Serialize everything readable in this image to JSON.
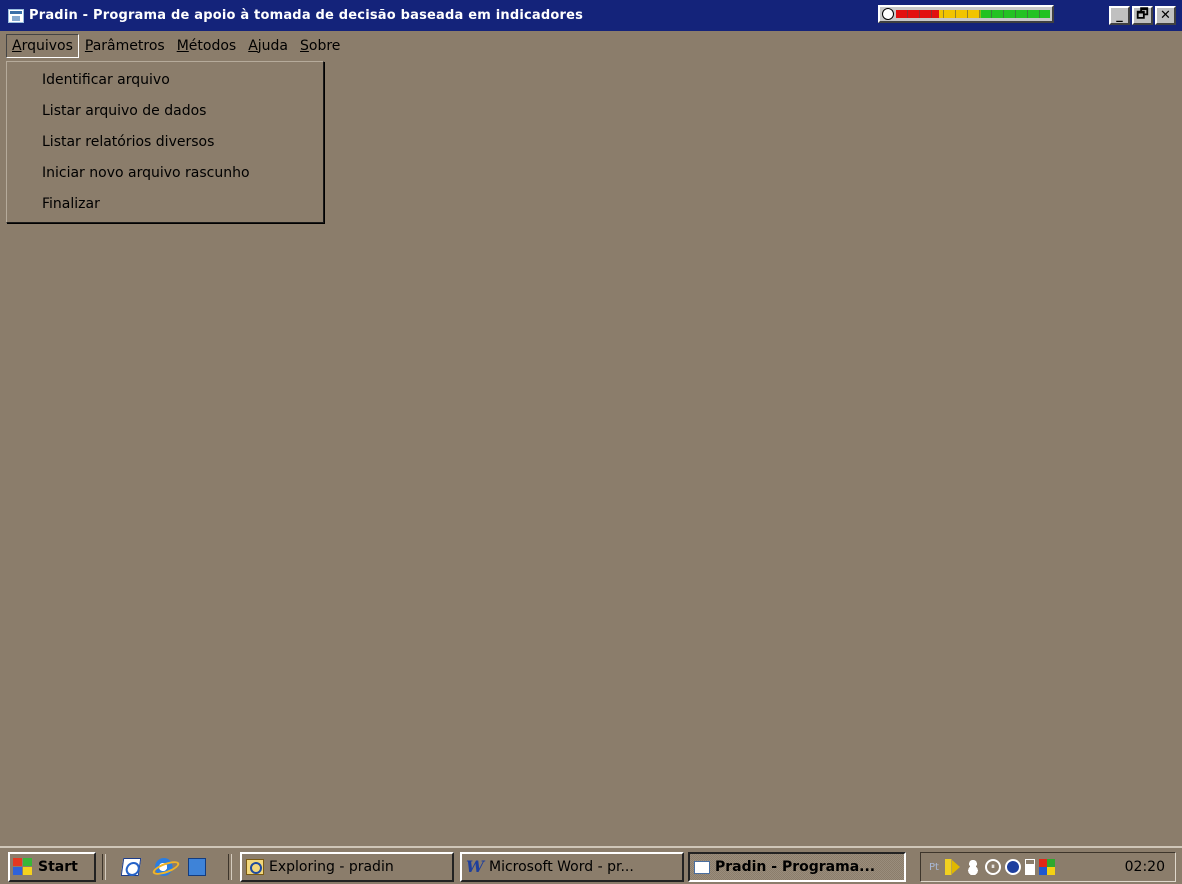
{
  "window": {
    "title": "Pradin - Programa de apoio à tomada de decisão baseada em indicadores",
    "buttons": {
      "minimize": "_",
      "restore": "🗗",
      "close": "✕"
    }
  },
  "menubar": [
    {
      "label": "Arquivos",
      "accel": "A",
      "rest": "rquivos",
      "active": true
    },
    {
      "label": "Parâmetros",
      "accel": "P",
      "rest": "arâmetros",
      "active": false
    },
    {
      "label": "Métodos",
      "accel": "M",
      "rest": "étodos",
      "active": false
    },
    {
      "label": "Ajuda",
      "accel": "A",
      "rest": "juda",
      "active": false
    },
    {
      "label": "Sobre",
      "accel": "S",
      "rest": "obre",
      "active": false
    }
  ],
  "dropdown": {
    "items": [
      "Identificar arquivo",
      "Listar arquivo de dados",
      "Listar relatórios diversos",
      "Iniciar novo arquivo rascunho",
      "Finalizar"
    ]
  },
  "taskbar": {
    "start_label": "Start",
    "tasks": [
      {
        "label": "Exploring - pradin",
        "icon": "explorer-icon"
      },
      {
        "label": "Microsoft Word - pr...",
        "icon": "word-icon"
      },
      {
        "label": "Pradin - Programa...",
        "icon": "pradin-icon",
        "pressed": true
      }
    ],
    "tray": {
      "input_lang": "Pt",
      "time": "02:20"
    }
  },
  "colors": {
    "titlebar": "#14237a",
    "desktop": "#8b7d6b"
  }
}
